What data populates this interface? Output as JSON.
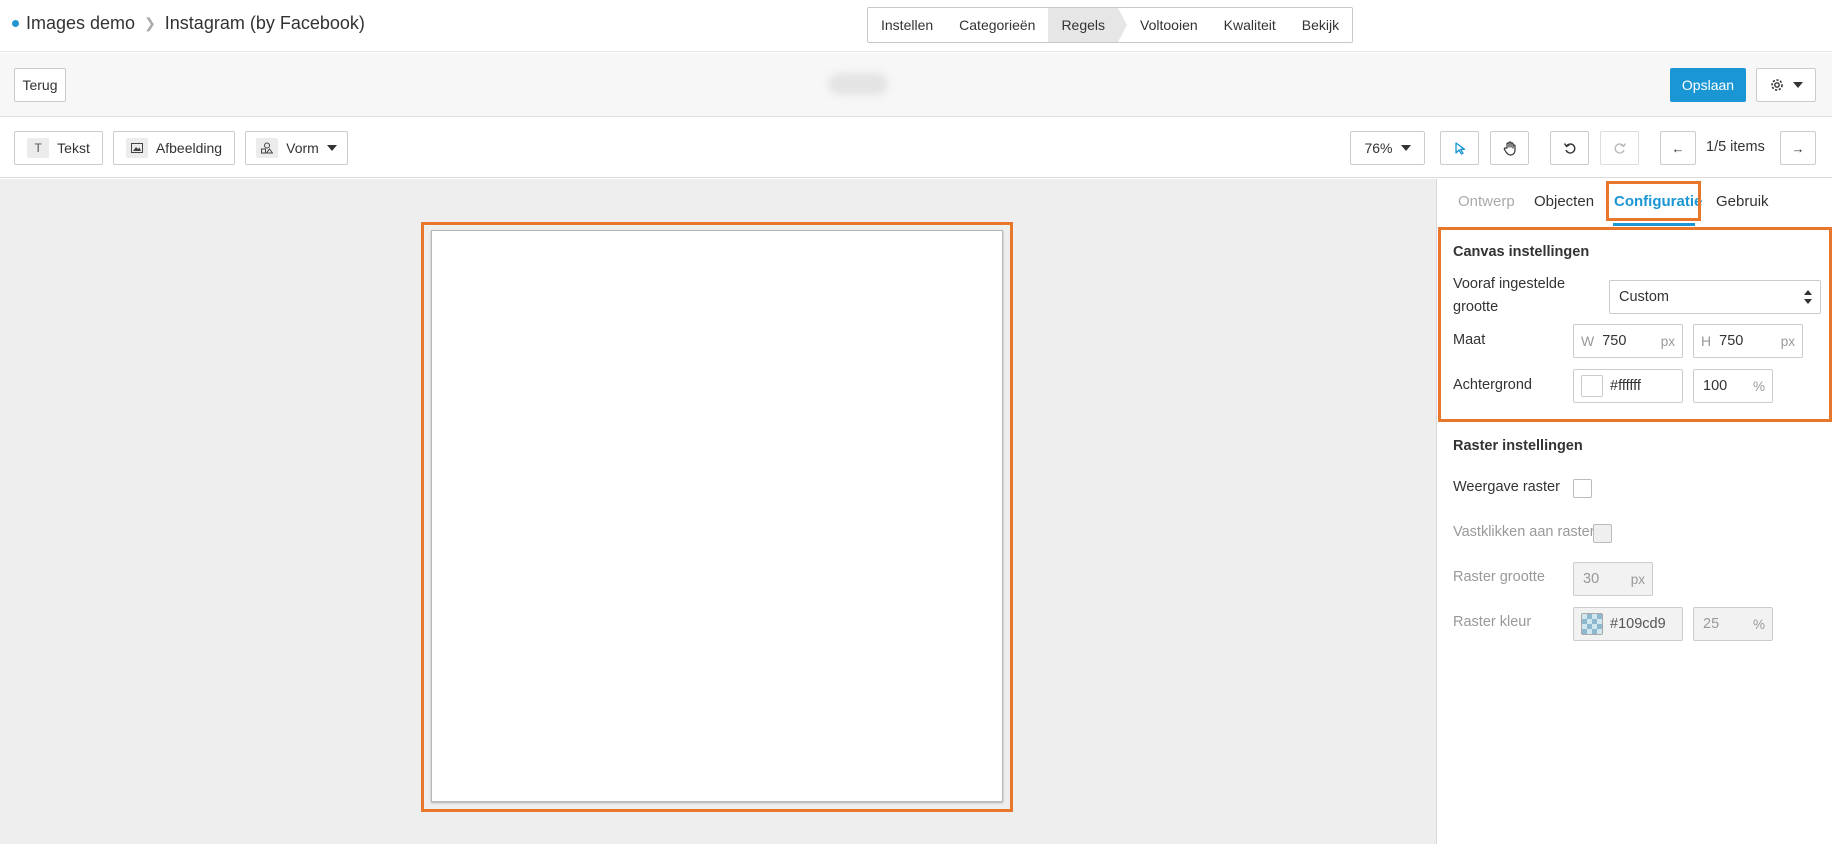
{
  "breadcrumb": {
    "root": "Images demo",
    "current": "Instagram (by Facebook)"
  },
  "steps": [
    "Instellen",
    "Categorieën",
    "Regels",
    "Voltooien",
    "Kwaliteit",
    "Bekijk"
  ],
  "header": {
    "back_label": "Terug",
    "save_label": "Opslaan"
  },
  "toolbar": {
    "text_label": "Tekst",
    "image_label": "Afbeelding",
    "shape_label": "Vorm",
    "zoom": "76%",
    "pagination": "1/5 items"
  },
  "panel": {
    "tabs": [
      "Ontwerp",
      "Objecten",
      "Configuratie",
      "Gebruik"
    ],
    "active_tab": "Configuratie",
    "canvas": {
      "title": "Canvas instellingen",
      "preset_label": "Vooraf ingestelde grootte",
      "preset_value": "Custom",
      "size_label": "Maat",
      "width_prefix": "W",
      "width": "750",
      "height_prefix": "H",
      "height": "750",
      "unit": "px",
      "bg_label": "Achtergrond",
      "bg_color": "#ffffff",
      "bg_opacity": "100",
      "percent": "%"
    },
    "grid": {
      "title": "Raster instellingen",
      "show_label": "Weergave raster",
      "snap_label": "Vastklikken aan raster",
      "size_label": "Raster grootte",
      "size": "30",
      "color_label": "Raster kleur",
      "color": "#109cd9",
      "opacity": "25"
    }
  },
  "colors": {
    "accent": "#1a96d4",
    "highlight": "#e8762b"
  }
}
